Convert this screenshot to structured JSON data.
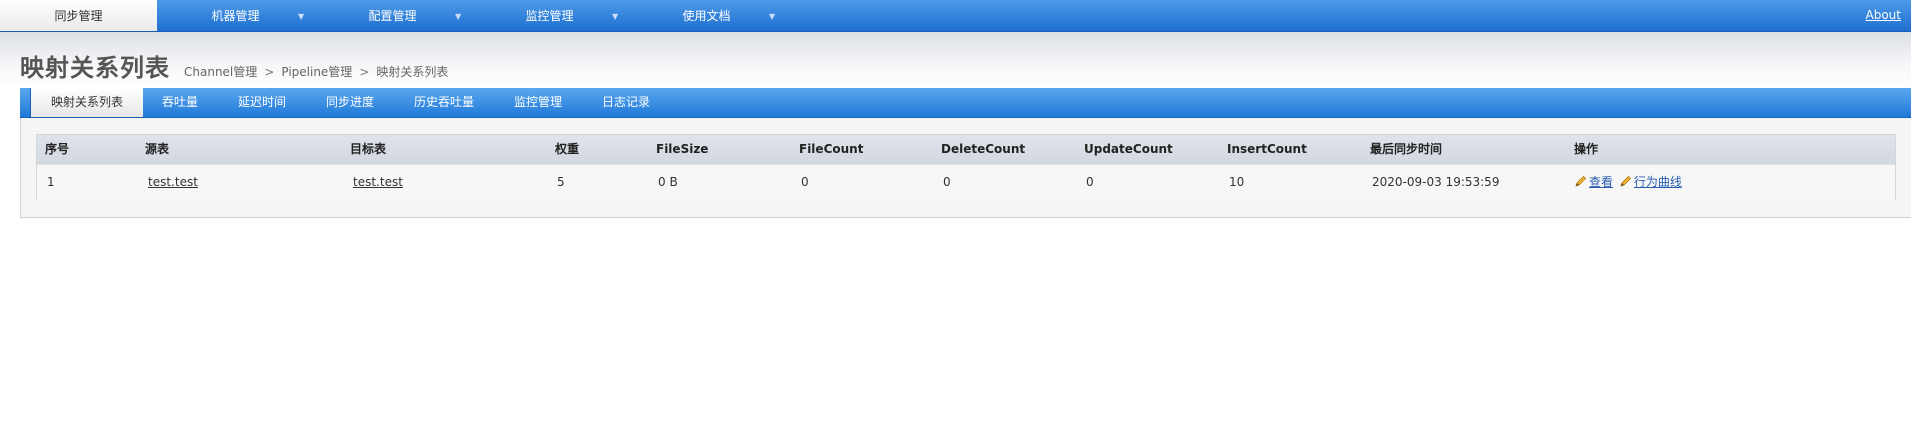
{
  "topnav": {
    "items": [
      {
        "label": "同步管理",
        "active": true,
        "has_dropdown": false
      },
      {
        "label": "机器管理",
        "active": false,
        "has_dropdown": true
      },
      {
        "label": "配置管理",
        "active": false,
        "has_dropdown": true
      },
      {
        "label": "监控管理",
        "active": false,
        "has_dropdown": true
      },
      {
        "label": "使用文档",
        "active": false,
        "has_dropdown": true
      }
    ],
    "dropdown_glyph": "▼",
    "about": "About"
  },
  "page": {
    "title": "映射关系列表"
  },
  "breadcrumb": {
    "items": [
      "Channel管理",
      "Pipeline管理",
      "映射关系列表"
    ],
    "separator": ">"
  },
  "subnav": {
    "tabs": [
      {
        "label": "映射关系列表",
        "active": true
      },
      {
        "label": "吞吐量",
        "active": false
      },
      {
        "label": "延迟时间",
        "active": false
      },
      {
        "label": "同步进度",
        "active": false
      },
      {
        "label": "历史吞吐量",
        "active": false
      },
      {
        "label": "监控管理",
        "active": false
      },
      {
        "label": "日志记录",
        "active": false
      }
    ]
  },
  "table": {
    "columns": [
      "序号",
      "源表",
      "目标表",
      "权重",
      "FileSize",
      "FileCount",
      "DeleteCount",
      "UpdateCount",
      "InsertCount",
      "最后同步时间",
      "操作"
    ],
    "rows": [
      {
        "index": "1",
        "source": "test.test",
        "target": "test.test",
        "weight": "5",
        "file_size": "0 B",
        "file_count": "0",
        "delete_count": "0",
        "update_count": "0",
        "insert_count": "10",
        "last_sync": "2020-09-03 19:53:59",
        "actions": [
          "查看",
          "行为曲线"
        ]
      }
    ]
  },
  "colors": {
    "nav_blue": "#2a7ddb",
    "link": "#2a5db0",
    "title": "#555555",
    "pencil": "#e8a317"
  },
  "icons": {
    "action_icon": "pencil-icon"
  }
}
